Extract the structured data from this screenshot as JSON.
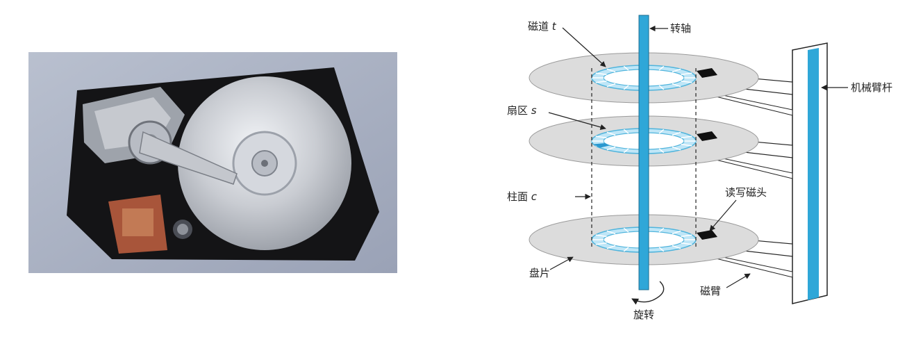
{
  "photo": {
    "subject": "hard-disk-drive-open"
  },
  "diagram": {
    "labels": {
      "track": "磁道",
      "track_var": "t",
      "spindle": "转轴",
      "arm_assembly": "机械臂杆",
      "sector": "扇区",
      "sector_var": "s",
      "cylinder": "柱面",
      "cylinder_var": "c",
      "read_write_head": "读写磁头",
      "platter": "盘片",
      "arm": "磁臂",
      "rotation": "旋转"
    },
    "colors": {
      "spindle": "#2fa7d8",
      "track_ring": "#bfe6f7",
      "track_stroke": "#4fb4dc",
      "sector_highlight": "#2a98cf",
      "platter": "#dcdcdc",
      "head": "#111111"
    }
  }
}
